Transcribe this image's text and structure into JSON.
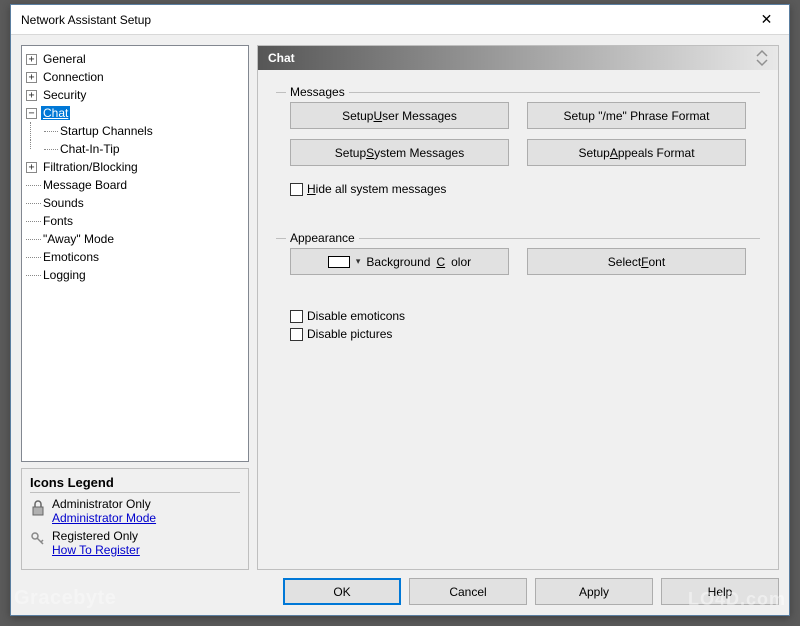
{
  "window": {
    "title": "Network Assistant Setup",
    "close_label": "✕"
  },
  "tree": {
    "general": "General",
    "connection": "Connection",
    "security": "Security",
    "chat": "Chat",
    "startup_channels": "Startup Channels",
    "chat_in_tip": "Chat-In-Tip",
    "filtration": "Filtration/Blocking",
    "message_board": "Message Board",
    "sounds": "Sounds",
    "fonts": "Fonts",
    "away_mode": "\"Away\" Mode",
    "emoticons": "Emoticons",
    "logging": "Logging"
  },
  "legend": {
    "title": "Icons Legend",
    "admin_only": "Administrator Only",
    "admin_mode": "Administrator Mode",
    "reg_only": "Registered Only",
    "howto": "How To Register"
  },
  "panel": {
    "header": "Chat",
    "group_messages": "Messages",
    "btn_user_messages_pre": "Setup ",
    "btn_user_messages_u": "U",
    "btn_user_messages_post": "ser Messages",
    "btn_me_format": "Setup \"/me\" Phrase Format",
    "btn_sys_msgs_pre": "Setup ",
    "btn_sys_msgs_u": "S",
    "btn_sys_msgs_post": "ystem Messages",
    "btn_appeals_pre": "Setup ",
    "btn_appeals_u": "A",
    "btn_appeals_post": "ppeals Format",
    "chk_hide_u": "H",
    "chk_hide_post": "ide all system messages",
    "group_appearance": "Appearance",
    "bgcolor_pre": "Background ",
    "bgcolor_u": "C",
    "bgcolor_post": "olor",
    "select_font_pre": "Select ",
    "select_font_u": "F",
    "select_font_post": "ont",
    "chk_disable_emoticons": "Disable emoticons",
    "chk_disable_pictures": "Disable pictures"
  },
  "buttons": {
    "ok": "OK",
    "cancel": "Cancel",
    "apply": "Apply",
    "help": "Help"
  },
  "watermarks": {
    "left": "Gracebyte",
    "right": "LO4D.com"
  }
}
